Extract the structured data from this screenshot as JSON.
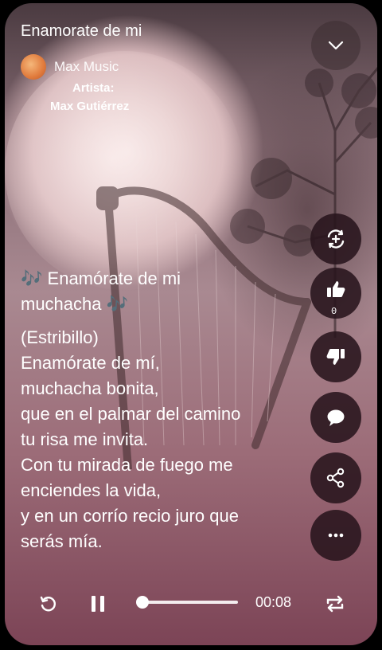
{
  "header": {
    "title": "Enamorate de mi"
  },
  "channel": {
    "name": "Max Music"
  },
  "artist": {
    "label": "Artista:",
    "name": "Max Gutiérrez"
  },
  "lyrics": {
    "song_line_1": "Enamórate de mi",
    "song_line_2": "muchacha",
    "note_glyph": "🎶",
    "lines": [
      "(Estribillo)",
      "Enamórate de mí,",
      "muchacha bonita,",
      "que en el palmar del camino",
      "tu risa me invita.",
      "Con tu mirada de fuego me",
      "enciendes la vida,",
      "y en un corrío recio juro que",
      "serás mía."
    ]
  },
  "actions": {
    "like_count": "0"
  },
  "player": {
    "time": "00:08",
    "progress": 0.0
  }
}
